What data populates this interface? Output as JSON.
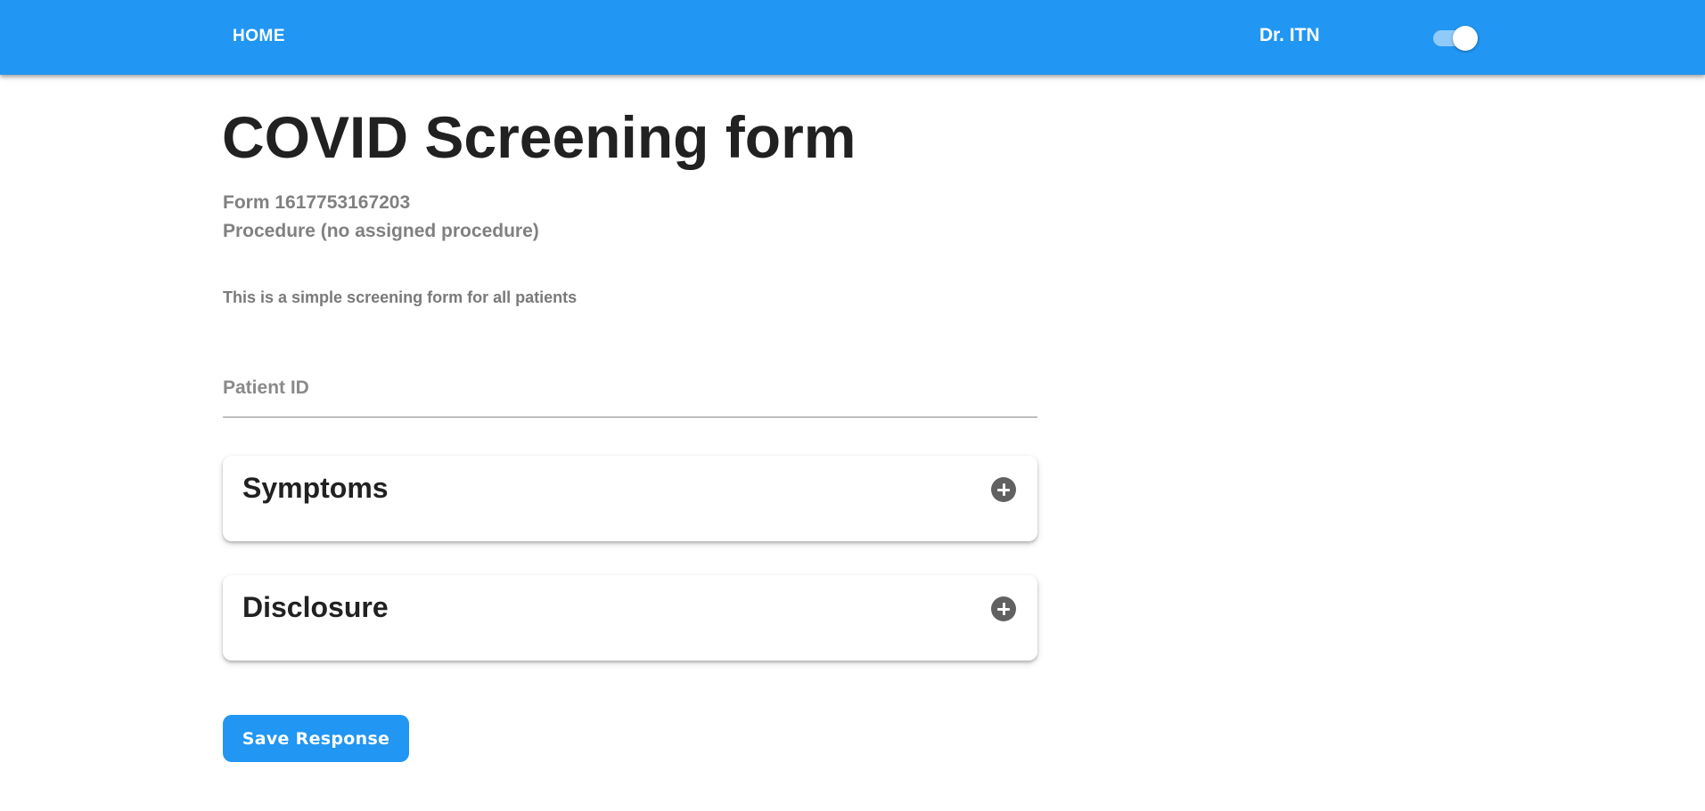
{
  "nav": {
    "home_label": "HOME",
    "user_name": "Dr. ITN",
    "theme_toggle_on": true
  },
  "form": {
    "title": "COVID Screening form",
    "form_line": "Form 1617753167203",
    "procedure_line": "Procedure (no assigned procedure)",
    "description": "This is a simple screening form for all patients",
    "patient_id": {
      "placeholder": "Patient ID",
      "value": ""
    },
    "sections": [
      {
        "title": "Symptoms",
        "icon": "add-circle-icon"
      },
      {
        "title": "Disclosure",
        "icon": "add-circle-icon"
      }
    ],
    "save_label": "Save Response"
  },
  "colors": {
    "primary": "#2196f3",
    "toggle_track": "#90caf9",
    "muted_text": "#808080",
    "icon_gray": "#616161",
    "heading_text": "#212121"
  }
}
